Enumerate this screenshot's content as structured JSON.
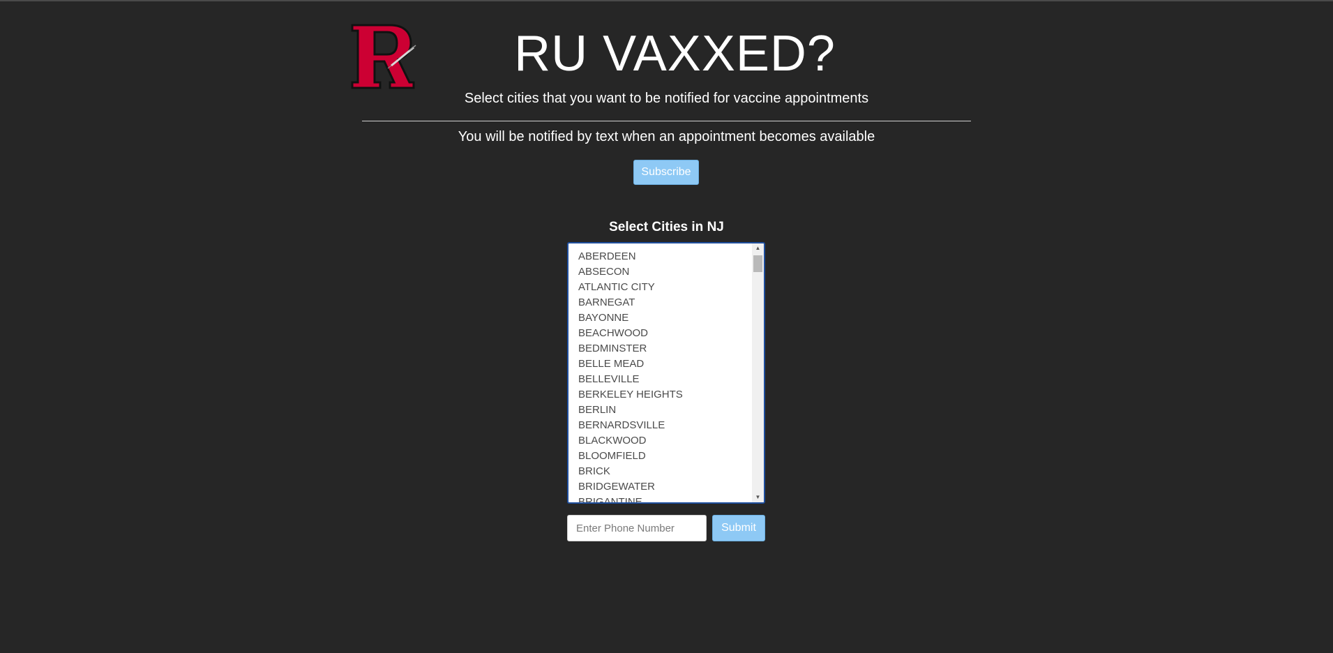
{
  "header": {
    "title": "RU VAXXED?",
    "subtitle": "Select cities that you want to be notified for vaccine appointments",
    "logo_icon": "rutgers-r-syringe-logo"
  },
  "notify": {
    "text": "You will be notified by text when an appointment becomes available",
    "subscribe_label": "Subscribe"
  },
  "cities": {
    "heading": "Select Cities in NJ",
    "items": [
      "ABERDEEN",
      "ABSECON",
      "ATLANTIC CITY",
      "BARNEGAT",
      "BAYONNE",
      "BEACHWOOD",
      "BEDMINSTER",
      "BELLE MEAD",
      "BELLEVILLE",
      "BERKELEY HEIGHTS",
      "BERLIN",
      "BERNARDSVILLE",
      "BLACKWOOD",
      "BLOOMFIELD",
      "BRICK",
      "BRIDGEWATER",
      "BRIGANTINE"
    ]
  },
  "form": {
    "phone_placeholder": "Enter Phone Number",
    "submit_label": "Submit"
  },
  "colors": {
    "background": "#262626",
    "button": "#8ec9f5",
    "logo_red": "#cc0033",
    "list_focus_border": "#1f4f9e"
  }
}
